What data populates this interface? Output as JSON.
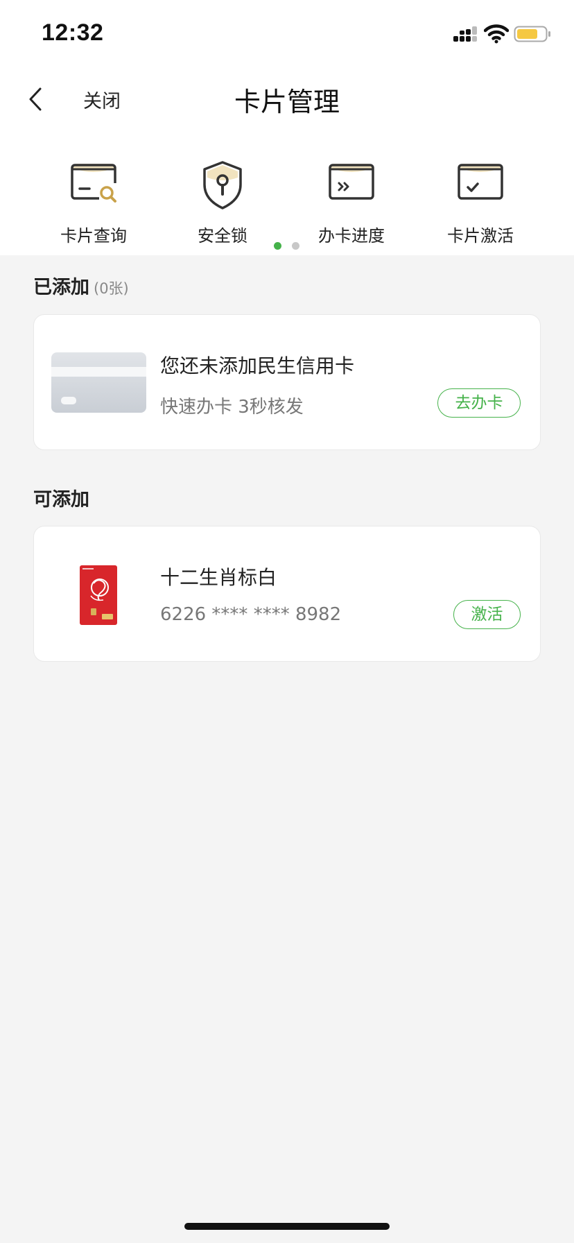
{
  "status_bar": {
    "time": "12:32"
  },
  "nav": {
    "close_label": "关闭",
    "title": "卡片管理"
  },
  "shortcuts": [
    {
      "label": "卡片查询",
      "icon": "card-search-icon"
    },
    {
      "label": "安全锁",
      "icon": "security-lock-icon"
    },
    {
      "label": "办卡进度",
      "icon": "card-progress-icon"
    },
    {
      "label": "卡片激活",
      "icon": "card-activate-icon"
    }
  ],
  "pager": {
    "pages": 2,
    "active": 0
  },
  "added": {
    "title": "已添加",
    "count": "(0张)",
    "empty_card": {
      "line1": "您还未添加民生信用卡",
      "line2": "快速办卡 3秒核发",
      "button": "去办卡"
    }
  },
  "addable": {
    "title": "可添加",
    "cards": [
      {
        "name": "十二生肖标白",
        "number": "6226 **** **** 8982",
        "button": "激活"
      }
    ]
  },
  "colors": {
    "accent_green": "#45b24a",
    "icon_gold": "#c9a24a",
    "card_red": "#d8262b",
    "battery_yellow": "#f5c842"
  }
}
